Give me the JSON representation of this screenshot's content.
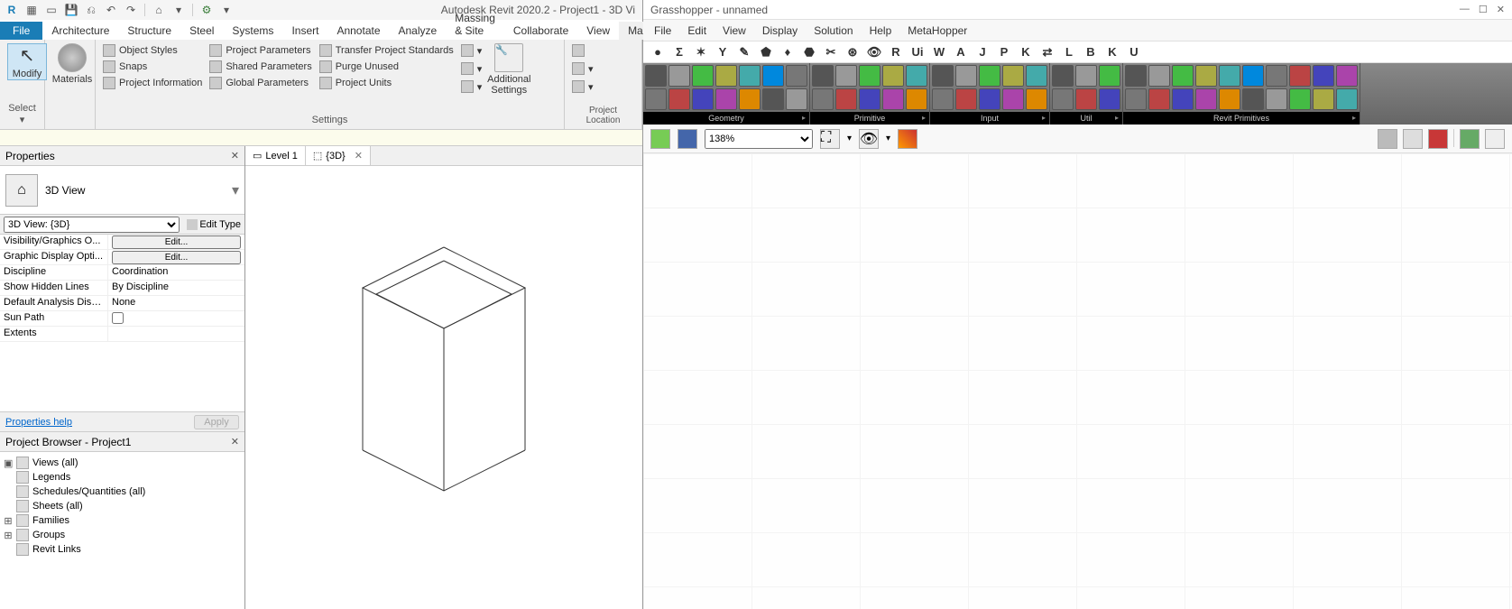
{
  "revit": {
    "title": "Autodesk Revit 2020.2 - Project1 - 3D Vi",
    "qat": [
      "R",
      "▦",
      "▭",
      "💾",
      "⎙",
      "↶",
      "↷",
      "|",
      "⌂",
      "▾",
      "|",
      "⚙",
      "▾"
    ],
    "tabs": {
      "file": "File",
      "items": [
        "Architecture",
        "Structure",
        "Steel",
        "Systems",
        "Insert",
        "Annotate",
        "Analyze",
        "Massing & Site",
        "Collaborate",
        "View",
        "Manage"
      ],
      "active": "Manage"
    },
    "ribbon": {
      "modify": "Modify",
      "materials": "Materials",
      "styles": [
        "Object  Styles",
        "Snaps",
        "Project  Information"
      ],
      "params": [
        "Project  Parameters",
        "Shared  Parameters",
        "Global  Parameters"
      ],
      "transfer": [
        "Transfer  Project Standards",
        "Purge  Unused",
        "Project  Units"
      ],
      "settings_label": "Settings",
      "select_label": "Select ▾",
      "additional": "Additional\nSettings",
      "location_label": "Project Location"
    },
    "properties": {
      "title": "Properties",
      "view": "3D View",
      "type": "3D View: {3D}",
      "edit_type": "Edit Type",
      "rows": [
        {
          "k": "Visibility/Graphics O...",
          "v": "Edit...",
          "btn": true
        },
        {
          "k": "Graphic Display Opti...",
          "v": "Edit...",
          "btn": true
        },
        {
          "k": "Discipline",
          "v": "Coordination"
        },
        {
          "k": "Show Hidden Lines",
          "v": "By Discipline"
        },
        {
          "k": "Default Analysis Disp...",
          "v": "None"
        },
        {
          "k": "Sun Path",
          "v": "",
          "check": true
        },
        {
          "k": "Extents",
          "v": ""
        }
      ],
      "help": "Properties help",
      "apply": "Apply"
    },
    "browser": {
      "title": "Project Browser - Project1",
      "items": [
        {
          "exp": "▣",
          "icon": "views",
          "label": "Views (all)"
        },
        {
          "exp": "",
          "icon": "legends",
          "label": "Legends"
        },
        {
          "exp": "",
          "icon": "sched",
          "label": "Schedules/Quantities (all)"
        },
        {
          "exp": "",
          "icon": "sheets",
          "label": "Sheets (all)"
        },
        {
          "exp": "⊞",
          "icon": "fam",
          "label": "Families"
        },
        {
          "exp": "⊞",
          "icon": "groups",
          "label": "Groups"
        },
        {
          "exp": "",
          "icon": "links",
          "label": "Revit Links"
        }
      ]
    },
    "viewtabs": [
      {
        "label": "Level 1",
        "active": false
      },
      {
        "label": "{3D}",
        "active": true
      }
    ]
  },
  "gh": {
    "title": "Grasshopper - unnamed",
    "win": [
      "—",
      "☐",
      "✕"
    ],
    "menu": [
      "File",
      "Edit",
      "View",
      "Display",
      "Solution",
      "Help",
      "MetaHopper"
    ],
    "iconrow": [
      "●",
      "Σ",
      "✶",
      "Y",
      "✎",
      "⬟",
      "♦",
      "⬣",
      "✂",
      "⊛",
      "👁",
      "R",
      "Ui",
      "W",
      "A",
      "J",
      "P",
      "K",
      "⇄",
      "L",
      "B",
      "K",
      "U"
    ],
    "groups": [
      {
        "name": "Geometry",
        "n": 14
      },
      {
        "name": "Primitive",
        "n": 10
      },
      {
        "name": "Input",
        "n": 10
      },
      {
        "name": "Util",
        "n": 6
      },
      {
        "name": "Revit Primitives",
        "n": 20
      }
    ],
    "zoom": "138%",
    "toolbar_left": [
      "open",
      "save"
    ],
    "toolbar_mid": [
      "fit",
      "▾",
      "eye",
      "▾",
      "sketch"
    ],
    "toolbar_right": [
      "sphere",
      "gem",
      "ruby",
      "|",
      "cyl",
      "more"
    ]
  }
}
